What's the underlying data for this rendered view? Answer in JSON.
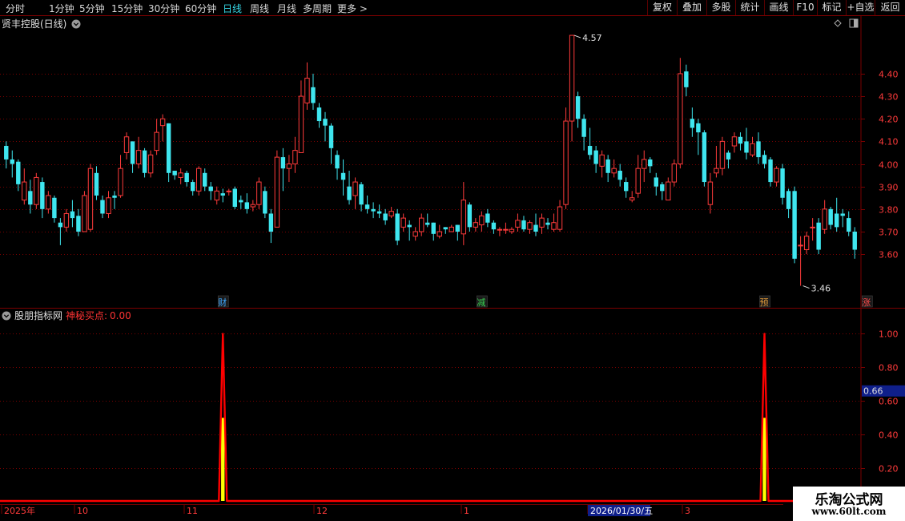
{
  "toolbar": {
    "left_tabs": [
      "分时",
      "1分钟",
      "5分钟",
      "15分钟",
      "30分钟",
      "60分钟",
      "日线",
      "周线",
      "月线",
      "多周期",
      "更多 >"
    ],
    "active_tab": "日线",
    "right_buttons": [
      "复权",
      "叠加",
      "多股",
      "统计",
      "画线",
      "F10",
      "标记",
      "+自选",
      "返回"
    ]
  },
  "main_panel": {
    "title": "贤丰控股(日线)",
    "high_label": "4.57",
    "low_label": "3.46",
    "markers": [
      {
        "label": "财",
        "color": "#3fa9ff"
      },
      {
        "label": "减",
        "color": "#39d353"
      },
      {
        "label": "预",
        "color": "#e09a3a"
      },
      {
        "label": "涨",
        "color": "#ff4a4a"
      }
    ]
  },
  "indicator_panel": {
    "title": "股朋指标网",
    "indicator_label": "神秘买点:",
    "indicator_value": "0.00",
    "cursor_value": "0.66"
  },
  "time_axis": {
    "labels": [
      "2025年",
      "10",
      "11",
      "12",
      "1",
      "2026/01/30/五",
      "3"
    ]
  },
  "watermark": {
    "title": "乐淘公式网",
    "url": "www.60lt.com"
  },
  "colors": {
    "up": "#ff3b3b",
    "down": "#3fe6ef",
    "grid": "#7a0000",
    "signal_line": "#ff0000",
    "signal_fill": "#ffff00"
  },
  "chart_data": [
    {
      "type": "candlestick",
      "title": "贤丰控股(日线)",
      "y_axis_ticks": [
        4.4,
        4.3,
        4.2,
        4.1,
        4.0,
        3.9,
        3.8,
        3.7,
        3.6
      ],
      "ylim": [
        3.43,
        4.62
      ],
      "annotations": [
        {
          "text": "4.57",
          "value": 4.57
        },
        {
          "text": "3.46",
          "value": 3.46
        }
      ],
      "candles": [
        [
          4.08,
          4.02,
          4.1,
          3.98
        ],
        [
          4.02,
          4.0,
          4.06,
          3.94
        ],
        [
          4.01,
          3.91,
          4.02,
          3.88
        ],
        [
          3.84,
          3.92,
          3.98,
          3.82
        ],
        [
          3.88,
          3.82,
          3.93,
          3.78
        ],
        [
          3.82,
          3.94,
          3.96,
          3.8
        ],
        [
          3.92,
          3.8,
          3.94,
          3.76
        ],
        [
          3.8,
          3.86,
          3.88,
          3.78
        ],
        [
          3.85,
          3.76,
          3.86,
          3.74
        ],
        [
          3.74,
          3.72,
          3.76,
          3.64
        ],
        [
          3.72,
          3.78,
          3.8,
          3.7
        ],
        [
          3.79,
          3.76,
          3.84,
          3.72
        ],
        [
          3.77,
          3.7,
          3.8,
          3.68
        ],
        [
          3.7,
          3.86,
          3.88,
          3.7
        ],
        [
          3.71,
          3.98,
          4.0,
          3.7
        ],
        [
          3.96,
          3.86,
          3.99,
          3.84
        ],
        [
          3.84,
          3.78,
          3.86,
          3.76
        ],
        [
          3.78,
          3.85,
          3.88,
          3.76
        ],
        [
          3.86,
          3.85,
          3.88,
          3.8
        ],
        [
          3.86,
          3.98,
          4.04,
          3.85
        ],
        [
          4.05,
          4.12,
          4.14,
          4.02
        ],
        [
          4.1,
          4.0,
          4.1,
          3.96
        ],
        [
          4.0,
          4.06,
          4.12,
          3.98
        ],
        [
          4.06,
          3.96,
          4.07,
          3.94
        ],
        [
          3.96,
          4.04,
          4.06,
          3.94
        ],
        [
          4.06,
          4.14,
          4.2,
          4.04
        ],
        [
          4.17,
          4.2,
          4.22,
          4.1
        ],
        [
          4.18,
          3.96,
          4.18,
          3.92
        ],
        [
          3.97,
          3.95,
          3.97,
          3.93
        ],
        [
          3.94,
          3.96,
          3.98,
          3.91
        ],
        [
          3.96,
          3.92,
          3.97,
          3.9
        ],
        [
          3.92,
          3.88,
          3.93,
          3.86
        ],
        [
          3.88,
          3.98,
          3.99,
          3.86
        ],
        [
          3.96,
          3.9,
          3.98,
          3.88
        ],
        [
          3.9,
          3.88,
          3.92,
          3.84
        ],
        [
          3.84,
          3.88,
          3.9,
          3.82
        ],
        [
          3.87,
          3.86,
          3.89,
          3.83
        ],
        [
          3.88,
          3.88,
          3.89,
          3.86
        ],
        [
          3.89,
          3.81,
          3.9,
          3.8
        ],
        [
          3.84,
          3.83,
          3.86,
          3.8
        ],
        [
          3.83,
          3.8,
          3.87,
          3.78
        ],
        [
          3.81,
          3.82,
          3.84,
          3.79
        ],
        [
          3.82,
          3.92,
          3.94,
          3.8
        ],
        [
          3.88,
          3.78,
          3.9,
          3.76
        ],
        [
          3.78,
          3.7,
          3.8,
          3.65
        ],
        [
          3.72,
          4.03,
          4.06,
          3.72
        ],
        [
          4.03,
          3.98,
          4.07,
          3.88
        ],
        [
          3.98,
          4.0,
          4.04,
          3.92
        ],
        [
          4.0,
          4.06,
          4.12,
          3.96
        ],
        [
          4.05,
          4.3,
          4.37,
          4.05
        ],
        [
          4.27,
          4.38,
          4.45,
          4.24
        ],
        [
          4.34,
          4.27,
          4.4,
          4.24
        ],
        [
          4.25,
          4.19,
          4.27,
          4.16
        ],
        [
          4.2,
          4.17,
          4.23,
          4.1
        ],
        [
          4.17,
          4.07,
          4.18,
          4.0
        ],
        [
          4.04,
          3.98,
          4.06,
          3.93
        ],
        [
          3.96,
          3.93,
          4.02,
          3.86
        ],
        [
          3.9,
          3.84,
          3.97,
          3.82
        ],
        [
          3.86,
          3.92,
          3.94,
          3.8
        ],
        [
          3.91,
          3.82,
          3.92,
          3.79
        ],
        [
          3.82,
          3.8,
          3.86,
          3.78
        ],
        [
          3.8,
          3.79,
          3.83,
          3.76
        ],
        [
          3.79,
          3.78,
          3.82,
          3.76
        ],
        [
          3.78,
          3.75,
          3.8,
          3.73
        ],
        [
          3.77,
          3.79,
          3.81,
          3.76
        ],
        [
          3.78,
          3.66,
          3.8,
          3.64
        ],
        [
          3.72,
          3.76,
          3.78,
          3.7
        ],
        [
          3.73,
          3.72,
          3.75,
          3.66
        ],
        [
          3.68,
          3.7,
          3.72,
          3.66
        ],
        [
          3.7,
          3.76,
          3.78,
          3.68
        ],
        [
          3.74,
          3.73,
          3.78,
          3.72
        ],
        [
          3.74,
          3.69,
          3.74,
          3.66
        ],
        [
          3.68,
          3.7,
          3.73,
          3.67
        ],
        [
          3.72,
          3.71,
          3.72,
          3.69
        ],
        [
          3.7,
          3.72,
          3.73,
          3.7
        ],
        [
          3.73,
          3.7,
          3.73,
          3.66
        ],
        [
          3.69,
          3.84,
          3.92,
          3.64
        ],
        [
          3.82,
          3.72,
          3.83,
          3.7
        ],
        [
          3.72,
          3.74,
          3.76,
          3.7
        ],
        [
          3.73,
          3.77,
          3.79,
          3.7
        ],
        [
          3.78,
          3.74,
          3.8,
          3.72
        ],
        [
          3.74,
          3.71,
          3.75,
          3.69
        ],
        [
          3.71,
          3.71,
          3.72,
          3.68
        ],
        [
          3.71,
          3.71,
          3.74,
          3.69
        ],
        [
          3.7,
          3.71,
          3.72,
          3.69
        ],
        [
          3.72,
          3.75,
          3.78,
          3.7
        ],
        [
          3.75,
          3.71,
          3.77,
          3.7
        ],
        [
          3.71,
          3.74,
          3.75,
          3.69
        ],
        [
          3.73,
          3.7,
          3.78,
          3.68
        ],
        [
          3.72,
          3.76,
          3.78,
          3.69
        ],
        [
          3.74,
          3.73,
          3.76,
          3.71
        ],
        [
          3.71,
          3.74,
          3.78,
          3.7
        ],
        [
          3.71,
          3.81,
          3.84,
          3.7
        ],
        [
          3.82,
          4.19,
          4.25,
          3.8
        ],
        [
          4.19,
          4.57,
          4.57,
          4.1
        ],
        [
          4.3,
          4.2,
          4.32,
          4.16
        ],
        [
          4.2,
          4.12,
          4.22,
          4.06
        ],
        [
          4.08,
          4.04,
          4.16,
          4.02
        ],
        [
          4.06,
          4.0,
          4.08,
          3.96
        ],
        [
          3.99,
          4.04,
          4.06,
          3.94
        ],
        [
          4.02,
          3.96,
          4.04,
          3.92
        ],
        [
          3.96,
          3.98,
          4.02,
          3.94
        ],
        [
          3.97,
          3.93,
          4.0,
          3.9
        ],
        [
          3.92,
          3.88,
          3.94,
          3.85
        ],
        [
          3.84,
          3.85,
          3.88,
          3.83
        ],
        [
          3.87,
          3.98,
          4.04,
          3.85
        ],
        [
          3.98,
          4.02,
          4.06,
          3.92
        ],
        [
          4.02,
          3.99,
          4.03,
          3.96
        ],
        [
          3.94,
          3.9,
          3.96,
          3.86
        ],
        [
          3.91,
          3.88,
          3.92,
          3.84
        ],
        [
          3.84,
          3.92,
          3.94,
          3.84
        ],
        [
          3.92,
          4.0,
          4.02,
          3.9
        ],
        [
          4.0,
          4.4,
          4.47,
          3.98
        ],
        [
          4.41,
          4.34,
          4.44,
          4.3
        ],
        [
          4.2,
          4.16,
          4.25,
          4.12
        ],
        [
          4.18,
          4.14,
          4.2,
          4.04
        ],
        [
          4.14,
          3.92,
          4.15,
          3.9
        ],
        [
          3.82,
          3.92,
          3.96,
          3.78
        ],
        [
          3.96,
          3.98,
          4.08,
          3.94
        ],
        [
          3.98,
          4.1,
          4.12,
          3.95
        ],
        [
          4.05,
          4.02,
          4.06,
          3.98
        ],
        [
          4.08,
          4.12,
          4.14,
          4.05
        ],
        [
          4.12,
          4.09,
          4.14,
          4.06
        ],
        [
          4.1,
          4.05,
          4.16,
          4.02
        ],
        [
          4.04,
          4.09,
          4.12,
          4.03
        ],
        [
          4.1,
          4.03,
          4.14,
          4.0
        ],
        [
          4.04,
          4.0,
          4.06,
          3.98
        ],
        [
          4.02,
          3.92,
          4.03,
          3.9
        ],
        [
          3.92,
          3.98,
          3.99,
          3.9
        ],
        [
          3.98,
          3.85,
          4.0,
          3.82
        ],
        [
          3.88,
          3.8,
          3.89,
          3.76
        ],
        [
          3.88,
          3.58,
          3.9,
          3.56
        ],
        [
          3.64,
          3.64,
          3.68,
          3.46
        ],
        [
          3.62,
          3.68,
          3.7,
          3.6
        ],
        [
          3.72,
          3.72,
          3.76,
          3.66
        ],
        [
          3.74,
          3.62,
          3.76,
          3.6
        ],
        [
          3.71,
          3.8,
          3.84,
          3.69
        ],
        [
          3.8,
          3.73,
          3.81,
          3.71
        ],
        [
          3.78,
          3.72,
          3.85,
          3.7
        ],
        [
          3.78,
          3.77,
          3.8,
          3.72
        ],
        [
          3.76,
          3.7,
          3.79,
          3.68
        ],
        [
          3.7,
          3.62,
          3.72,
          3.58
        ]
      ]
    },
    {
      "type": "area",
      "title": "股朋指标网",
      "series_name": "神秘买点",
      "y_axis_ticks": [
        1.0,
        0.8,
        0.6,
        0.4,
        0.2
      ],
      "ylim": [
        0,
        1.05
      ],
      "signals": [
        {
          "bar": 36,
          "value": 1.0
        },
        {
          "bar": 126,
          "value": 1.0
        }
      ],
      "fill_value": 0.5,
      "cursor_value": 0.66
    }
  ]
}
